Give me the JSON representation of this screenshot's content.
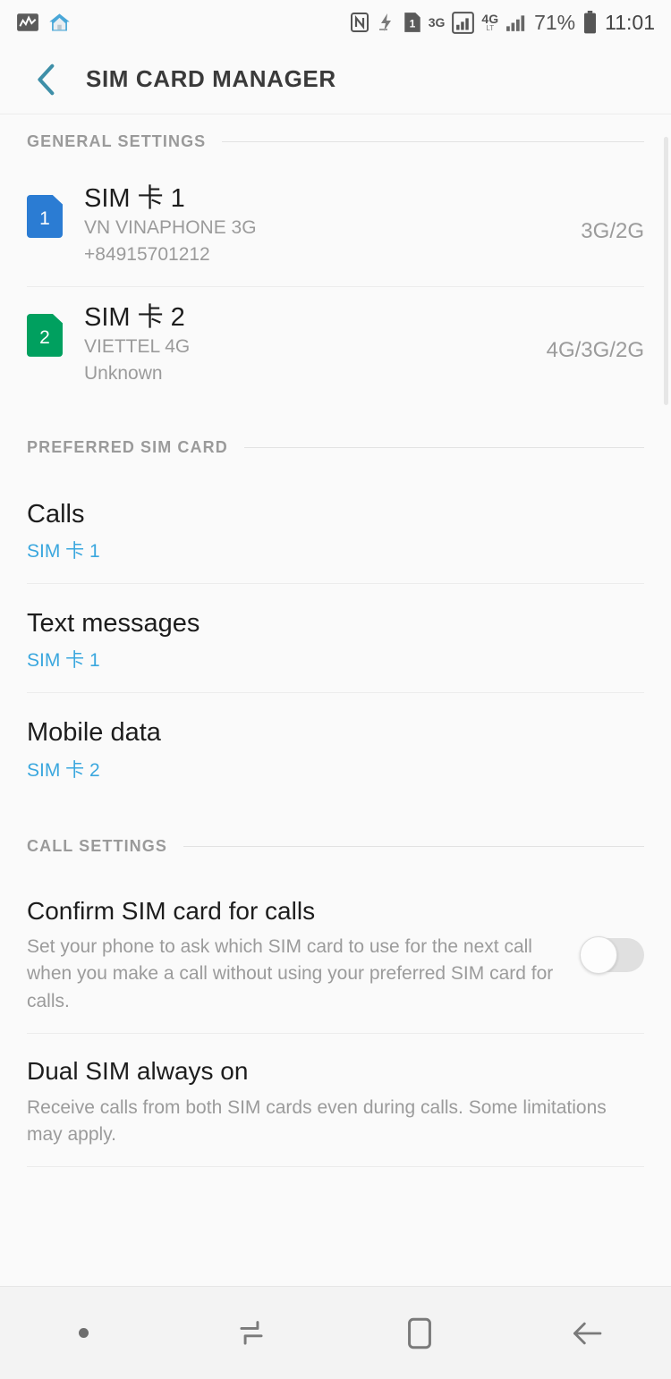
{
  "status_bar": {
    "left_icons": [
      {
        "name": "activity-monitor-icon",
        "glyph": "chart"
      },
      {
        "name": "home-app-icon",
        "glyph": "house"
      }
    ],
    "right_icons": [
      {
        "name": "nfc-icon",
        "label": "N"
      },
      {
        "name": "vibrate-icon",
        "label": "vibrate"
      },
      {
        "name": "sim-1-icon",
        "label": "1"
      },
      {
        "name": "network-3g-icon",
        "label": "3G",
        "sub": ""
      },
      {
        "name": "signal-bars-sim1-icon",
        "label": "signal"
      },
      {
        "name": "network-4g-icon",
        "label": "4G",
        "sub": "LTE"
      },
      {
        "name": "signal-bars-sim2-icon",
        "label": "signal"
      }
    ],
    "battery_percent": "71%",
    "battery_icon": "battery-icon",
    "time": "11:01"
  },
  "header": {
    "back_label": "back-chevron",
    "title": "SIM CARD MANAGER",
    "accent_color": "#3e8fa8"
  },
  "sections": {
    "general": {
      "label": "GENERAL SETTINGS",
      "sims": [
        {
          "badge": "1",
          "color": "#2b7cd3",
          "title": "SIM 卡 1",
          "carrier": "VN VINAPHONE 3G",
          "number": "+84915701212",
          "network": "3G/2G"
        },
        {
          "badge": "2",
          "color": "#00a05f",
          "title": "SIM 卡 2",
          "carrier": "VIETTEL 4G",
          "number": "Unknown",
          "network": "4G/3G/2G"
        }
      ]
    },
    "preferred": {
      "label": "PREFERRED SIM CARD",
      "accent_color": "#3aa7de",
      "items": [
        {
          "title": "Calls",
          "value": "SIM 卡 1"
        },
        {
          "title": "Text messages",
          "value": "SIM 卡 1"
        },
        {
          "title": "Mobile data",
          "value": "SIM 卡 2"
        }
      ]
    },
    "call_settings": {
      "label": "CALL SETTINGS",
      "items": [
        {
          "title": "Confirm SIM card for calls",
          "desc": "Set your phone to ask which SIM card to use for the next call when you make a call without using your preferred SIM card for calls.",
          "has_toggle": true,
          "toggle_on": false
        },
        {
          "title": "Dual SIM always on",
          "desc": "Receive calls from both SIM cards even during calls. Some limitations may apply.",
          "has_toggle": false,
          "toggle_on": false
        }
      ]
    }
  },
  "nav_bar": {
    "buttons": [
      {
        "name": "nav-dot-indicator",
        "glyph": "dot"
      },
      {
        "name": "nav-recents-button",
        "glyph": "recents"
      },
      {
        "name": "nav-home-button",
        "glyph": "home"
      },
      {
        "name": "nav-back-button",
        "glyph": "back"
      }
    ]
  }
}
